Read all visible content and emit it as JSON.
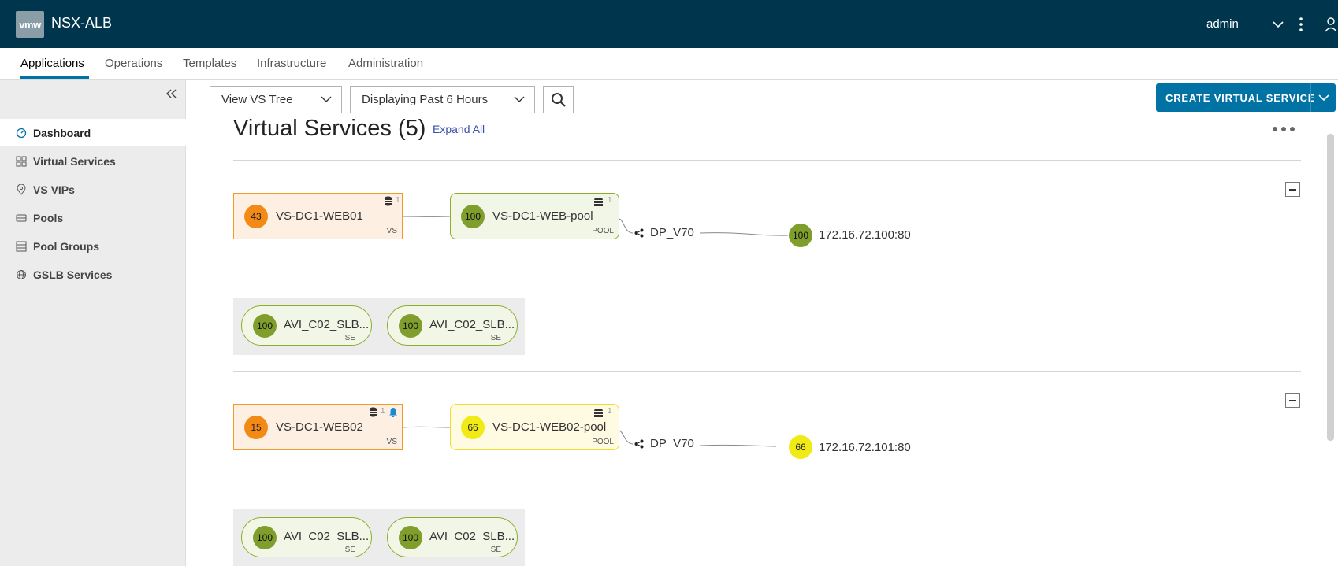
{
  "header": {
    "logo": "vmw",
    "product": "NSX-ALB",
    "user": "admin"
  },
  "nav": {
    "tabs": [
      {
        "label": "Applications",
        "active": true
      },
      {
        "label": "Operations"
      },
      {
        "label": "Templates"
      },
      {
        "label": "Infrastructure"
      },
      {
        "label": "Administration"
      }
    ]
  },
  "sidebar": {
    "items": [
      {
        "label": "Dashboard",
        "icon": "dashboard-icon",
        "active": true
      },
      {
        "label": "Virtual Services",
        "icon": "grid-icon"
      },
      {
        "label": "VS VIPs",
        "icon": "map-pin-icon"
      },
      {
        "label": "Pools",
        "icon": "server-icon"
      },
      {
        "label": "Pool Groups",
        "icon": "list-icon"
      },
      {
        "label": "GSLB Services",
        "icon": "globe-icon"
      }
    ]
  },
  "toolbar": {
    "view_select": "View VS Tree",
    "time_select": "Displaying Past 6 Hours",
    "create_label": "CREATE VIRTUAL SERVICE"
  },
  "main": {
    "title": "Virtual Services (5)",
    "expand_all": "Expand All",
    "trees": [
      {
        "vs": {
          "score": "43",
          "name": "VS-DC1-WEB01",
          "type": "VS",
          "count": "1",
          "alert": false
        },
        "pool": {
          "score": "100",
          "name": "VS-DC1-WEB-pool",
          "type": "POOL",
          "count": "1",
          "health": "green"
        },
        "network": "DP_V70",
        "server": {
          "score": "100",
          "ip": "172.16.72.100:80",
          "health": "green"
        },
        "ses": [
          {
            "score": "100",
            "name": "AVI_C02_SLB...",
            "type": "SE"
          },
          {
            "score": "100",
            "name": "AVI_C02_SLB...",
            "type": "SE"
          }
        ]
      },
      {
        "vs": {
          "score": "15",
          "name": "VS-DC1-WEB02",
          "type": "VS",
          "count": "1",
          "alert": true
        },
        "pool": {
          "score": "66",
          "name": "VS-DC1-WEB02-pool",
          "type": "POOL",
          "count": "1",
          "health": "yellow"
        },
        "network": "DP_V70",
        "server": {
          "score": "66",
          "ip": "172.16.72.101:80",
          "health": "yellow"
        },
        "ses": [
          {
            "score": "100",
            "name": "AVI_C02_SLB...",
            "type": "SE"
          },
          {
            "score": "100",
            "name": "AVI_C02_SLB...",
            "type": "SE"
          }
        ]
      }
    ]
  },
  "colors": {
    "header_bg": "#00364d",
    "accent": "#0072a3",
    "health_orange": "#f48a16",
    "health_green": "#7f9e2b",
    "health_yellow": "#f0ea16"
  }
}
